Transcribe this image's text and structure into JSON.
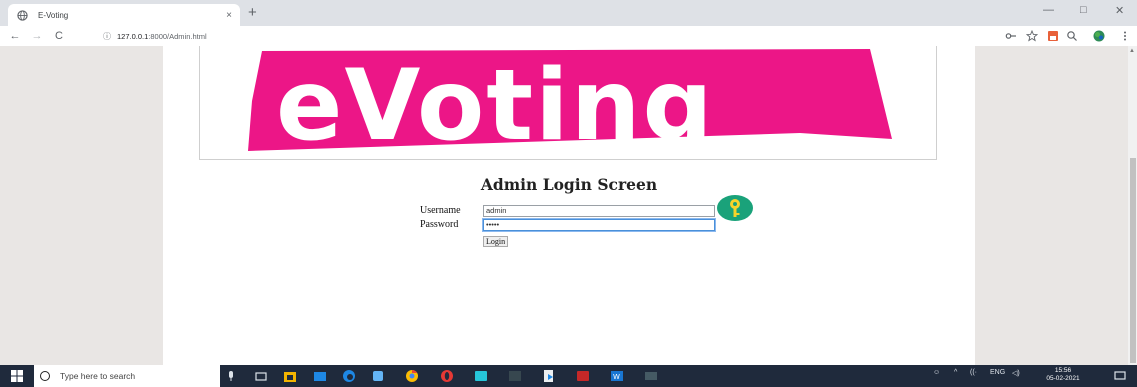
{
  "browser": {
    "tab_title": "E-Voting",
    "tab_close": "×",
    "new_tab": "+",
    "url_host": "127.0.0.1",
    "url_path": ":8000/Admin.html",
    "info_icon": "ⓘ",
    "back": "←",
    "forward": "→",
    "reload": "C",
    "minimize": "—",
    "restore": "□",
    "close": "✕"
  },
  "page": {
    "logo_text": "eVoting",
    "heading": "Admin Login Screen",
    "username_label": "Username",
    "username_value": "admin",
    "password_label": "Password",
    "password_value": "•••••",
    "login_button": "Login"
  },
  "taskbar": {
    "search_placeholder": "Type here to search",
    "time": "15:56",
    "date": "05-02-2021"
  },
  "colors": {
    "logo_pink": "#ec1687",
    "key_green": "#1aa27a",
    "key_yellow": "#f6d32b"
  }
}
